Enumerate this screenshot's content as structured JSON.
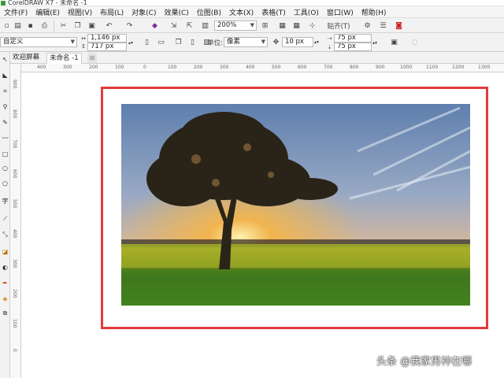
{
  "app": {
    "title": "CorelDRAW X7 - 未命名 -1"
  },
  "menu": [
    "文件(F)",
    "编辑(E)",
    "视图(V)",
    "布局(L)",
    "对象(C)",
    "效果(C)",
    "位图(B)",
    "文本(X)",
    "表格(T)",
    "工具(O)",
    "窗口(W)",
    "帮助(H)"
  ],
  "standard_toolbar": {
    "zoom": "200%",
    "snap_label": "贴齐(T)"
  },
  "property_bar": {
    "preset": "自定义",
    "width": "1,146 px",
    "height": "717 px",
    "units_label": "单位:",
    "units_value": "像素",
    "nudge": "10 px",
    "dup_x": "75 px",
    "dup_y": "75 px"
  },
  "tabs": [
    "欢迎屏幕",
    "未命名 -1"
  ],
  "ruler_h_ticks": [
    "400",
    "300",
    "200",
    "100",
    "0",
    "100",
    "200",
    "300",
    "400",
    "500",
    "600",
    "700",
    "800",
    "900",
    "1000",
    "1100",
    "1200",
    "1300"
  ],
  "ruler_v_ticks": [
    "900",
    "800",
    "700",
    "600",
    "500",
    "400",
    "300",
    "200",
    "100",
    "0"
  ],
  "watermark": "头条 @我家男神在哪",
  "colors": {
    "selection": "#e23b3b",
    "sky_top": "#5f7fae",
    "sun": "#f6b545",
    "grass": "#4a8a1e"
  }
}
